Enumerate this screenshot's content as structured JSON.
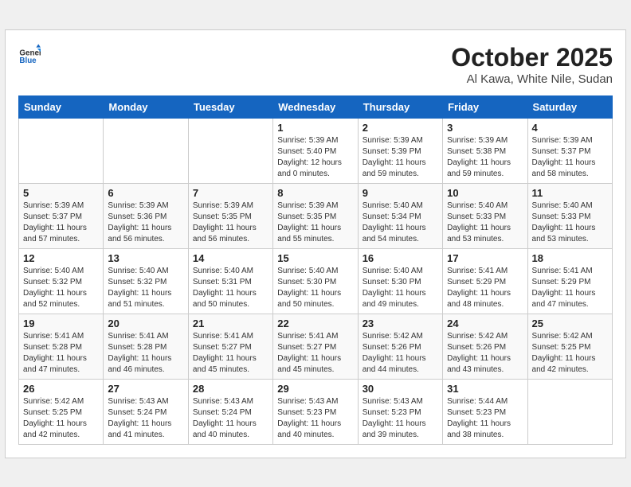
{
  "header": {
    "logo_general": "General",
    "logo_blue": "Blue",
    "title": "October 2025",
    "location": "Al Kawa, White Nile, Sudan"
  },
  "weekdays": [
    "Sunday",
    "Monday",
    "Tuesday",
    "Wednesday",
    "Thursday",
    "Friday",
    "Saturday"
  ],
  "weeks": [
    [
      {
        "day": "",
        "sunrise": "",
        "sunset": "",
        "daylight": ""
      },
      {
        "day": "",
        "sunrise": "",
        "sunset": "",
        "daylight": ""
      },
      {
        "day": "",
        "sunrise": "",
        "sunset": "",
        "daylight": ""
      },
      {
        "day": "1",
        "sunrise": "Sunrise: 5:39 AM",
        "sunset": "Sunset: 5:40 PM",
        "daylight": "Daylight: 12 hours and 0 minutes."
      },
      {
        "day": "2",
        "sunrise": "Sunrise: 5:39 AM",
        "sunset": "Sunset: 5:39 PM",
        "daylight": "Daylight: 11 hours and 59 minutes."
      },
      {
        "day": "3",
        "sunrise": "Sunrise: 5:39 AM",
        "sunset": "Sunset: 5:38 PM",
        "daylight": "Daylight: 11 hours and 59 minutes."
      },
      {
        "day": "4",
        "sunrise": "Sunrise: 5:39 AM",
        "sunset": "Sunset: 5:37 PM",
        "daylight": "Daylight: 11 hours and 58 minutes."
      }
    ],
    [
      {
        "day": "5",
        "sunrise": "Sunrise: 5:39 AM",
        "sunset": "Sunset: 5:37 PM",
        "daylight": "Daylight: 11 hours and 57 minutes."
      },
      {
        "day": "6",
        "sunrise": "Sunrise: 5:39 AM",
        "sunset": "Sunset: 5:36 PM",
        "daylight": "Daylight: 11 hours and 56 minutes."
      },
      {
        "day": "7",
        "sunrise": "Sunrise: 5:39 AM",
        "sunset": "Sunset: 5:35 PM",
        "daylight": "Daylight: 11 hours and 56 minutes."
      },
      {
        "day": "8",
        "sunrise": "Sunrise: 5:39 AM",
        "sunset": "Sunset: 5:35 PM",
        "daylight": "Daylight: 11 hours and 55 minutes."
      },
      {
        "day": "9",
        "sunrise": "Sunrise: 5:40 AM",
        "sunset": "Sunset: 5:34 PM",
        "daylight": "Daylight: 11 hours and 54 minutes."
      },
      {
        "day": "10",
        "sunrise": "Sunrise: 5:40 AM",
        "sunset": "Sunset: 5:33 PM",
        "daylight": "Daylight: 11 hours and 53 minutes."
      },
      {
        "day": "11",
        "sunrise": "Sunrise: 5:40 AM",
        "sunset": "Sunset: 5:33 PM",
        "daylight": "Daylight: 11 hours and 53 minutes."
      }
    ],
    [
      {
        "day": "12",
        "sunrise": "Sunrise: 5:40 AM",
        "sunset": "Sunset: 5:32 PM",
        "daylight": "Daylight: 11 hours and 52 minutes."
      },
      {
        "day": "13",
        "sunrise": "Sunrise: 5:40 AM",
        "sunset": "Sunset: 5:32 PM",
        "daylight": "Daylight: 11 hours and 51 minutes."
      },
      {
        "day": "14",
        "sunrise": "Sunrise: 5:40 AM",
        "sunset": "Sunset: 5:31 PM",
        "daylight": "Daylight: 11 hours and 50 minutes."
      },
      {
        "day": "15",
        "sunrise": "Sunrise: 5:40 AM",
        "sunset": "Sunset: 5:30 PM",
        "daylight": "Daylight: 11 hours and 50 minutes."
      },
      {
        "day": "16",
        "sunrise": "Sunrise: 5:40 AM",
        "sunset": "Sunset: 5:30 PM",
        "daylight": "Daylight: 11 hours and 49 minutes."
      },
      {
        "day": "17",
        "sunrise": "Sunrise: 5:41 AM",
        "sunset": "Sunset: 5:29 PM",
        "daylight": "Daylight: 11 hours and 48 minutes."
      },
      {
        "day": "18",
        "sunrise": "Sunrise: 5:41 AM",
        "sunset": "Sunset: 5:29 PM",
        "daylight": "Daylight: 11 hours and 47 minutes."
      }
    ],
    [
      {
        "day": "19",
        "sunrise": "Sunrise: 5:41 AM",
        "sunset": "Sunset: 5:28 PM",
        "daylight": "Daylight: 11 hours and 47 minutes."
      },
      {
        "day": "20",
        "sunrise": "Sunrise: 5:41 AM",
        "sunset": "Sunset: 5:28 PM",
        "daylight": "Daylight: 11 hours and 46 minutes."
      },
      {
        "day": "21",
        "sunrise": "Sunrise: 5:41 AM",
        "sunset": "Sunset: 5:27 PM",
        "daylight": "Daylight: 11 hours and 45 minutes."
      },
      {
        "day": "22",
        "sunrise": "Sunrise: 5:41 AM",
        "sunset": "Sunset: 5:27 PM",
        "daylight": "Daylight: 11 hours and 45 minutes."
      },
      {
        "day": "23",
        "sunrise": "Sunrise: 5:42 AM",
        "sunset": "Sunset: 5:26 PM",
        "daylight": "Daylight: 11 hours and 44 minutes."
      },
      {
        "day": "24",
        "sunrise": "Sunrise: 5:42 AM",
        "sunset": "Sunset: 5:26 PM",
        "daylight": "Daylight: 11 hours and 43 minutes."
      },
      {
        "day": "25",
        "sunrise": "Sunrise: 5:42 AM",
        "sunset": "Sunset: 5:25 PM",
        "daylight": "Daylight: 11 hours and 42 minutes."
      }
    ],
    [
      {
        "day": "26",
        "sunrise": "Sunrise: 5:42 AM",
        "sunset": "Sunset: 5:25 PM",
        "daylight": "Daylight: 11 hours and 42 minutes."
      },
      {
        "day": "27",
        "sunrise": "Sunrise: 5:43 AM",
        "sunset": "Sunset: 5:24 PM",
        "daylight": "Daylight: 11 hours and 41 minutes."
      },
      {
        "day": "28",
        "sunrise": "Sunrise: 5:43 AM",
        "sunset": "Sunset: 5:24 PM",
        "daylight": "Daylight: 11 hours and 40 minutes."
      },
      {
        "day": "29",
        "sunrise": "Sunrise: 5:43 AM",
        "sunset": "Sunset: 5:23 PM",
        "daylight": "Daylight: 11 hours and 40 minutes."
      },
      {
        "day": "30",
        "sunrise": "Sunrise: 5:43 AM",
        "sunset": "Sunset: 5:23 PM",
        "daylight": "Daylight: 11 hours and 39 minutes."
      },
      {
        "day": "31",
        "sunrise": "Sunrise: 5:44 AM",
        "sunset": "Sunset: 5:23 PM",
        "daylight": "Daylight: 11 hours and 38 minutes."
      },
      {
        "day": "",
        "sunrise": "",
        "sunset": "",
        "daylight": ""
      }
    ]
  ]
}
